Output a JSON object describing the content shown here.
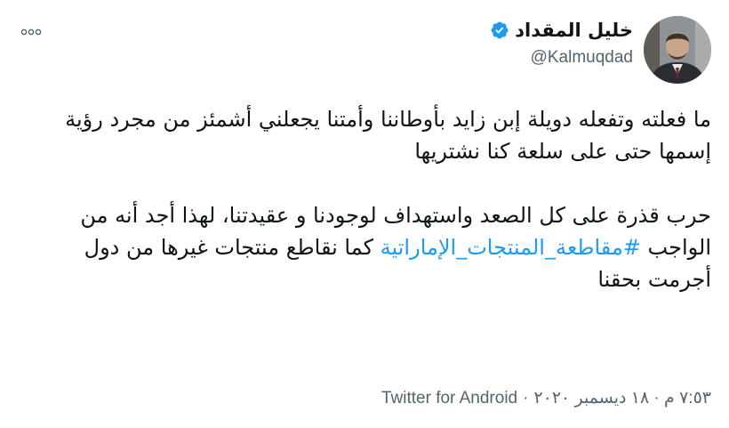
{
  "author": {
    "display_name": "خليل المقداد",
    "handle": "@Kalmuqdad",
    "verified": true
  },
  "tweet": {
    "paragraph1": "ما فعلته وتفعله دويلة إبن زايد بأوطاننا وأمتنا يجعلني أشمئز من مجرد رؤية إسمها حتى على سلعة كنا نشتريها",
    "paragraph2_before": "حرب قذرة على كل الصعد واستهداف لوجودنا و عقيدتنا، لهذا أجد أنه من الواجب ",
    "hashtag": "#مقاطعة_المنتجات_الإماراتية",
    "paragraph2_after": " كما نقاطع منتجات غيرها من دول أجرمت بحقنا"
  },
  "meta": {
    "timestamp": "٧:٥٣ م · ١٨ ديسمبر ٢٠٢٠",
    "separator": "·",
    "source": "Twitter for Android"
  },
  "icons": {
    "more": "more-horizontal-icon",
    "verified": "verified-badge-icon"
  },
  "colors": {
    "verified": "#1d9bf0",
    "hashtag": "#1d9bf0",
    "secondary_text": "#536471",
    "primary_text": "#0f1419"
  }
}
